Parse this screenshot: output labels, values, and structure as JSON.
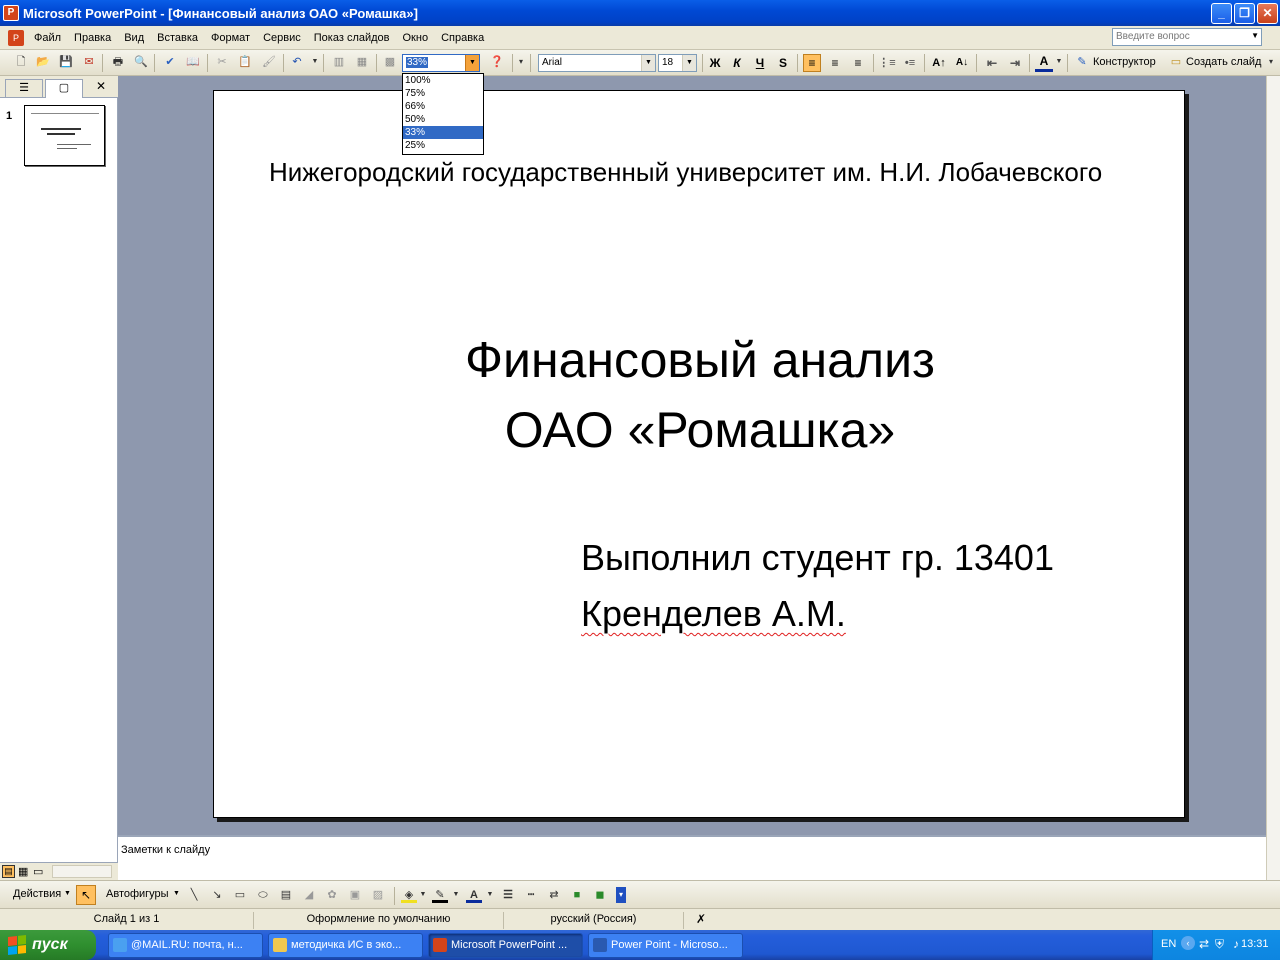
{
  "window": {
    "title": "Microsoft PowerPoint - [Финансовый анализ ОАО «Ромашка»]",
    "app_icon": "powerpoint-icon",
    "controls": [
      "minimize",
      "restore",
      "close"
    ]
  },
  "menu": {
    "items": [
      "Файл",
      "Правка",
      "Вид",
      "Вставка",
      "Формат",
      "Сервис",
      "Показ слайдов",
      "Окно",
      "Справка"
    ],
    "ask_placeholder": "Введите вопрос"
  },
  "toolbar": {
    "zoom_value": "33%",
    "zoom_options": [
      "100%",
      "75%",
      "66%",
      "50%",
      "33%",
      "25%"
    ],
    "zoom_selected_index": 4,
    "font_name": "Arial",
    "font_size": "18",
    "bold_label": "Ж",
    "italic_label": "К",
    "underline_label": "Ч",
    "shadow_label": "S",
    "designer_label": "Конструктор",
    "new_slide_label": "Создать слайд"
  },
  "left_pane": {
    "slide_number": "1"
  },
  "slide": {
    "university": "Нижегородский государственный университет им. Н.И. Лобачевского",
    "title_line1": "Финансовый анализ",
    "title_line2": "ОАО «Ромашка»",
    "author_line1": "Выполнил студент гр. 13401",
    "author_line2": "Кренделев А.М."
  },
  "notes": {
    "placeholder": "Заметки к слайду"
  },
  "drawing_toolbar": {
    "actions_label": "Действия",
    "autoshapes_label": "Автофигуры"
  },
  "status": {
    "slide_info": "Слайд 1 из 1",
    "design": "Оформление по умолчанию",
    "language": "русский (Россия)"
  },
  "taskbar": {
    "start_label": "пуск",
    "tasks": [
      {
        "label": "@MAIL.RU: почта, н...",
        "icon": "browser-icon"
      },
      {
        "label": "методичка ИС в эко...",
        "icon": "folder-icon"
      },
      {
        "label": "Microsoft PowerPoint ...",
        "icon": "powerpoint-icon"
      },
      {
        "label": "Power Point - Microso...",
        "icon": "word-icon"
      }
    ],
    "language": "EN",
    "clock": "13:31"
  },
  "colors": {
    "titlebar": "#0049d4",
    "selection": "#316ac5",
    "slide_area": "#8e98ae",
    "taskbar": "#245edb",
    "start_button": "#2f8f2f"
  }
}
